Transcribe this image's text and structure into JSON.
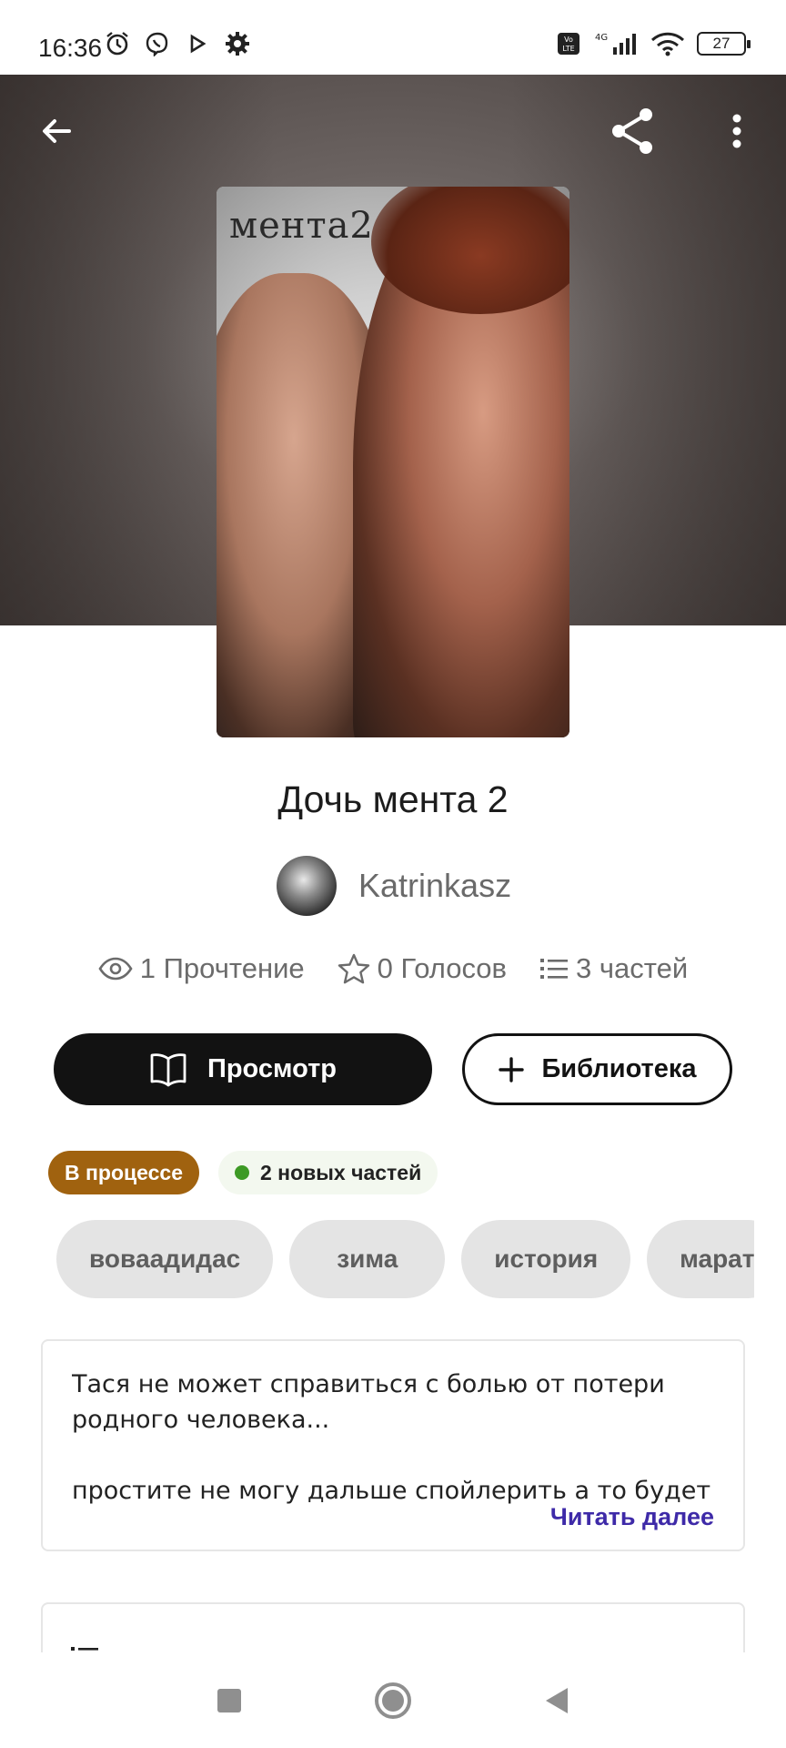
{
  "status_bar": {
    "time": "16:36",
    "battery": "27",
    "network": "4G"
  },
  "header": {
    "back_icon": "arrow-left-icon",
    "share_icon": "share-icon",
    "more_icon": "more-vertical-icon"
  },
  "book": {
    "cover_text": "мента2",
    "title": "Дочь мента 2",
    "author": "Katrinkasz",
    "stats": {
      "reads": "1 Прочтение",
      "votes": "0 Голосов",
      "parts": "3 частей"
    }
  },
  "actions": {
    "read_label": "Просмотр",
    "library_label": "Библиотека"
  },
  "badges": {
    "status": "В процессе",
    "new_parts": "2 новых частей"
  },
  "tags": [
    "вовaадидас",
    "зима",
    "история",
    "марат"
  ],
  "description": {
    "text": "Тася не может справиться с болью от потери родного человека...\n\nпростите не могу дальше спойлерить а то будет",
    "read_more": "Читать далее"
  },
  "colors": {
    "accent_link": "#3e2aa8",
    "status_badge": "#a0620f",
    "new_dot": "#3d9a25",
    "primary_button": "#121212"
  }
}
